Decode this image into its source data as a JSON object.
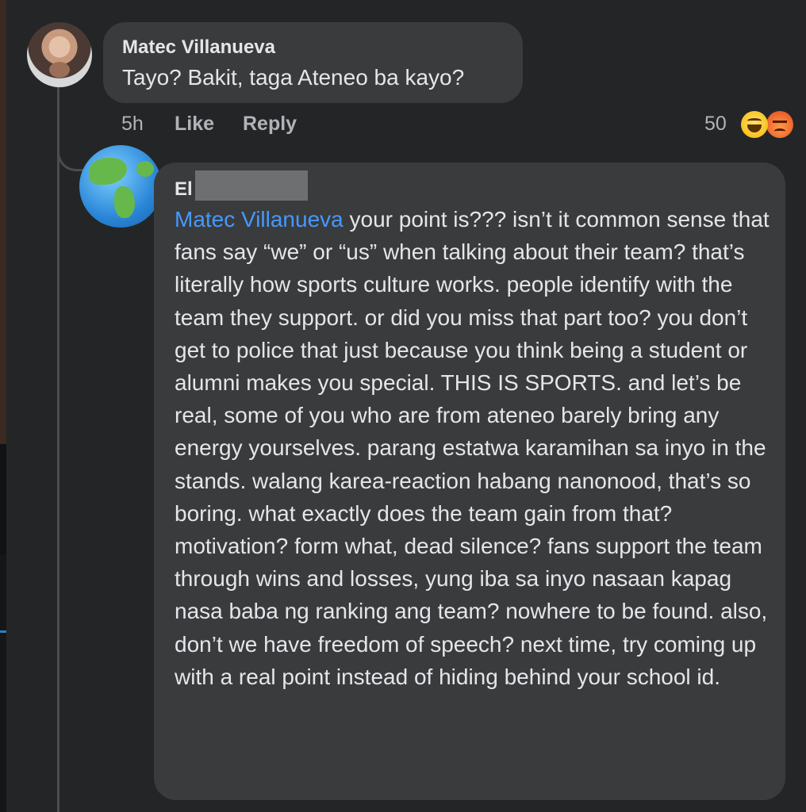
{
  "comment1": {
    "author": "Matec Villanueva",
    "text": "Tayo? Bakit, taga Ateneo ba kayo?",
    "time": "5h",
    "like_label": "Like",
    "reply_label": "Reply",
    "reaction_count": "50",
    "reactions": [
      "haha-icon",
      "angry-icon"
    ]
  },
  "reply": {
    "author_visible": "El",
    "mention": "Matec Villanueva",
    "text": " your point is??? isn’t it common sense that fans say “we” or “us” when talking about their team? that’s literally how sports culture works. people identify with the team they support. or did you miss that part too? you don’t get to police that just because you think being a student or alumni makes you special. THIS IS SPORTS. and let’s be real, some of you who are from ateneo barely bring any energy yourselves. parang estatwa karamihan sa inyo in the stands. walang karea-reaction habang nanonood, that’s so boring. what exactly does the team gain from that? motivation? form what, dead silence? fans support the team through wins and losses, yung iba sa inyo nasaan kapag nasa baba ng ranking ang team? nowhere to be found. also, don’t we have freedom of speech? next time, try coming up with a real point instead of hiding behind your school id."
  },
  "colors": {
    "background": "#242526",
    "bubble": "#3a3b3c",
    "text": "#e4e6eb",
    "muted": "#b0b3b8",
    "mention": "#4599ff"
  }
}
